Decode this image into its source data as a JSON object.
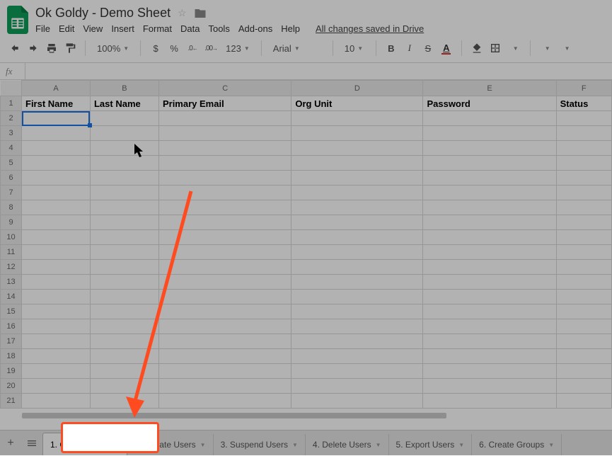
{
  "doc": {
    "title": "Ok Goldy - Demo Sheet",
    "save_status": "All changes saved in Drive"
  },
  "menu": [
    "File",
    "Edit",
    "View",
    "Insert",
    "Format",
    "Data",
    "Tools",
    "Add-ons",
    "Help"
  ],
  "toolbar": {
    "zoom": "100%",
    "currency": "$",
    "percent": "%",
    "dec_dec": ".0",
    "dec_inc": ".00",
    "formats": "123",
    "font": "Arial",
    "font_size": "10",
    "bold": "B",
    "italic": "I",
    "strike": "S",
    "textcolor": "A"
  },
  "formula": {
    "fx": "fx",
    "value": ""
  },
  "columns": [
    {
      "letter": "A",
      "width": 100,
      "header": "First Name"
    },
    {
      "letter": "B",
      "width": 100,
      "header": "Last Name"
    },
    {
      "letter": "C",
      "width": 195,
      "header": "Primary Email"
    },
    {
      "letter": "D",
      "width": 195,
      "header": "Org Unit"
    },
    {
      "letter": "E",
      "width": 195,
      "header": "Password"
    },
    {
      "letter": "F",
      "width": 80,
      "header": "Status"
    }
  ],
  "row_count": 21,
  "selected_cell": "A2",
  "sheet_tabs": [
    {
      "label": "1. Create Users",
      "active": true
    },
    {
      "label": "2. Update Users",
      "active": false
    },
    {
      "label": "3. Suspend Users",
      "active": false
    },
    {
      "label": "4. Delete Users",
      "active": false
    },
    {
      "label": "5. Export Users",
      "active": false
    },
    {
      "label": "6. Create Groups",
      "active": false
    }
  ]
}
